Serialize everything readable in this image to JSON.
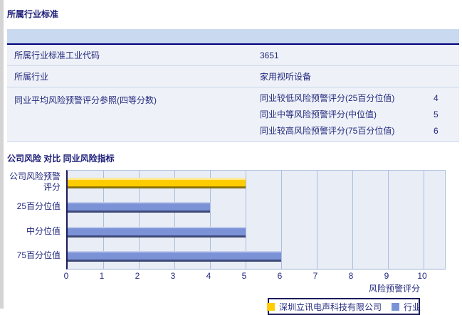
{
  "industry_section": {
    "title": "所属行业标准",
    "table": {
      "rows": [
        {
          "label": "所属行业标准工业代码",
          "value": "3651"
        },
        {
          "label": "所属行业",
          "value": "家用视听设备"
        },
        {
          "label": "同业平均风险预警评分参照(四等分数)",
          "sub": [
            {
              "label": "同业较低风险预警评分(25百分位值)",
              "value": "4"
            },
            {
              "label": "同业中等风险预警评分(中位值)",
              "value": "5"
            },
            {
              "label": "同业较高风险预警评分(75百分位值)",
              "value": "6"
            }
          ]
        }
      ]
    }
  },
  "chart_section": {
    "title": "公司风险 对比 同业风险指标"
  },
  "chart_data": {
    "type": "bar",
    "orientation": "horizontal",
    "title": "公司风险 对比 同业风险指标",
    "categories": [
      "公司风险预警评分",
      "25百分位值",
      "中分位值",
      "75百分位值"
    ],
    "values": [
      5,
      4,
      5,
      6
    ],
    "series_of_bar": [
      "company",
      "industry",
      "industry",
      "industry"
    ],
    "xlabel": "风险预警评分",
    "xlim": [
      0,
      10
    ],
    "x_ticks": [
      0,
      1,
      2,
      3,
      4,
      5,
      6,
      7,
      8,
      9,
      10
    ],
    "grid": true,
    "legend_position": "bottom-right",
    "legend": [
      {
        "series": "company",
        "label": "深圳立讯电声科技有限公司",
        "color": "#ffcc00"
      },
      {
        "series": "industry",
        "label": "行业",
        "color": "#7b93d6"
      }
    ],
    "colors": {
      "company": "#ffcc00",
      "industry": "#7b93d6"
    }
  }
}
